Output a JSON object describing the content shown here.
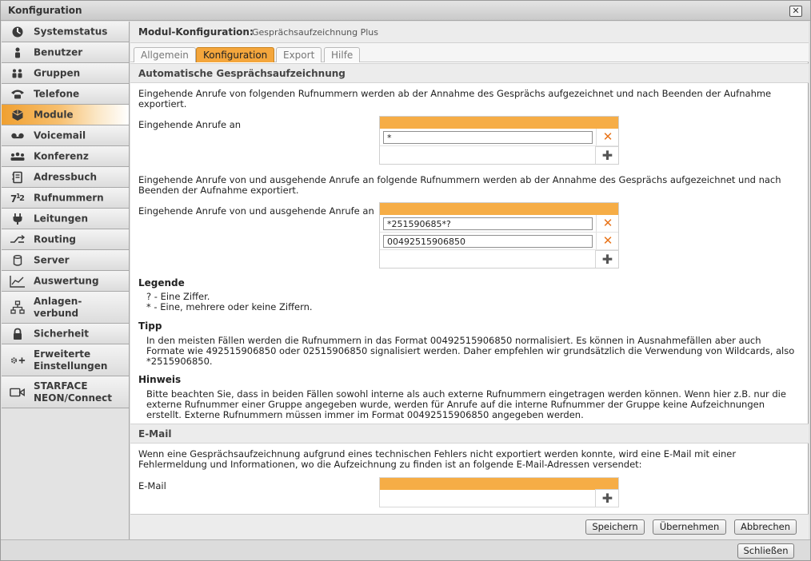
{
  "window": {
    "title": "Konfiguration",
    "close_symbol": "✕"
  },
  "sidebar": {
    "items": [
      {
        "label": "Systemstatus",
        "icon": "gauge-icon"
      },
      {
        "label": "Benutzer",
        "icon": "user-icon"
      },
      {
        "label": "Gruppen",
        "icon": "group-icon"
      },
      {
        "label": "Telefone",
        "icon": "phone-icon"
      },
      {
        "label": "Module",
        "icon": "box-icon",
        "active": true
      },
      {
        "label": "Voicemail",
        "icon": "voicemail-icon"
      },
      {
        "label": "Konferenz",
        "icon": "conference-icon"
      },
      {
        "label": "Adressbuch",
        "icon": "addressbook-icon"
      },
      {
        "label": "Rufnummern",
        "icon": "numbers-icon"
      },
      {
        "label": "Leitungen",
        "icon": "plug-icon"
      },
      {
        "label": "Routing",
        "icon": "routing-icon"
      },
      {
        "label": "Server",
        "icon": "server-icon"
      },
      {
        "label": "Auswertung",
        "icon": "chart-icon"
      },
      {
        "label": "Anlagen-\nverbund",
        "icon": "network-icon"
      },
      {
        "label": "Sicherheit",
        "icon": "lock-icon"
      },
      {
        "label": "Erweiterte\nEinstellungen",
        "icon": "gears-icon"
      },
      {
        "label": "STARFACE\nNEON/Connect",
        "icon": "video-icon"
      }
    ]
  },
  "module": {
    "label": "Modul-Konfiguration:",
    "name": "Gesprächsaufzeichnung Plus"
  },
  "tabs": [
    {
      "label": "Allgemein"
    },
    {
      "label": "Konfiguration",
      "active": true
    },
    {
      "label": "Export"
    },
    {
      "label": "Hilfe"
    }
  ],
  "auto_section": {
    "title": "Automatische Gesprächsaufzeichnung",
    "intro1": "Eingehende Anrufe von folgenden Rufnummern werden ab der Annahme des Gesprächs aufgezeichnet und nach Beenden der Aufnahme exportiert.",
    "label1": "Eingehende Anrufe an",
    "numbers1": [
      "*"
    ],
    "intro2": "Eingehende Anrufe von und ausgehende Anrufe an folgende Rufnummern werden ab der Annahme des Gesprächs aufgezeichnet und nach Beenden der Aufnahme exportiert.",
    "label2": "Eingehende Anrufe von und ausgehende Anrufe an",
    "numbers2": [
      "*251590685*?",
      "00492515906850"
    ],
    "delete_symbol": "✕",
    "add_symbol": "✚"
  },
  "legend": {
    "title": "Legende",
    "text": "? - Eine Ziffer.\n* - Eine, mehrere oder keine Ziffern."
  },
  "tip": {
    "title": "Tipp",
    "text": "In den meisten Fällen werden die Rufnummern in das Format 00492515906850 normalisiert. Es können in Ausnahmefällen aber auch Formate wie 492515906850 oder 02515906850 signalisiert werden. Daher empfehlen wir grundsätzlich die Verwendung von Wildcards, also *2515906850."
  },
  "hint": {
    "title": "Hinweis",
    "text": "Bitte beachten Sie, dass in beiden Fällen sowohl interne als auch externe Rufnummern eingetragen werden können. Wenn hier z.B. nur die externe Rufnummer einer Gruppe angegeben wurde, werden für Anrufe auf die interne Rufnummer der Gruppe keine Aufzeichnungen erstellt. Externe Rufnummern müssen immer im Format 00492515906850 angegeben werden."
  },
  "email_section": {
    "title": "E-Mail",
    "intro": "Wenn eine Gesprächsaufzeichnung aufgrund eines technischen Fehlers nicht exportiert werden konnte, wird eine E-Mail mit einer Fehlermeldung und Informationen, wo die Aufzeichnung zu finden ist an folgende E-Mail-Adressen versendet:",
    "label": "E-Mail"
  },
  "buttons": {
    "save": "Speichern",
    "apply": "Übernehmen",
    "cancel": "Abbrechen",
    "close": "Schließen"
  },
  "colors": {
    "accent": "#f4a63c",
    "delete": "#e8741a"
  }
}
